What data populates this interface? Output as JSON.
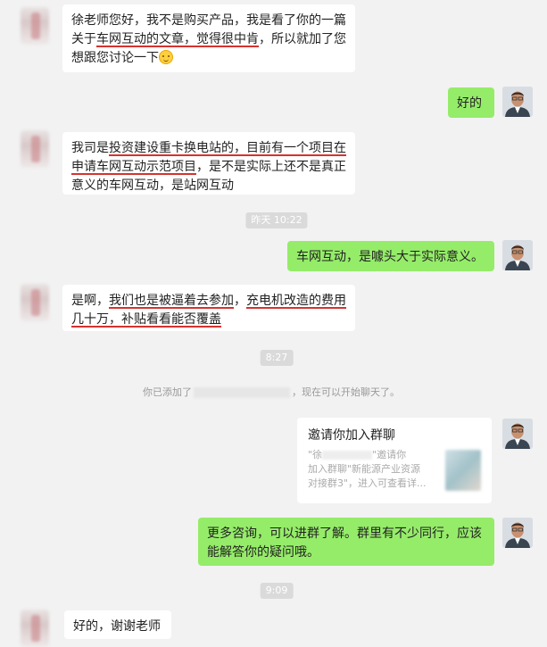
{
  "messages": {
    "m1": {
      "seg1": "徐老师您好，我不是购买产品，我是看了你的一篇",
      "seg2": "关于",
      "seg3": "车网互动的文章，觉得很中肯",
      "seg4": "，所以就加了您",
      "seg5": "想跟您讨论一下"
    },
    "m2": "好的",
    "m3": {
      "seg1": "我司是",
      "seg2": "投资建设重卡换电站的，目前有一个项目在",
      "seg3": "申请车网互动示范项目",
      "seg4": "，是不是实际上还不是真正",
      "seg5": "意义的车网互动，是站网互动"
    },
    "ts1": "昨天 10:22",
    "m4": "车网互动，是噱头大于实际意义。",
    "m5": {
      "seg1": "是啊，",
      "seg2": "我们也是被逼着去参加",
      "seg3": "，",
      "seg4": "充电机改造的费用",
      "seg5": "几十万，补贴看看能否覆盖"
    },
    "ts2": "8:27",
    "sys": {
      "prefix": "你已添加了",
      "suffix": "，现在可以开始聊天了。"
    },
    "card": {
      "title": "邀请你加入群聊",
      "line1": "\"徐",
      "line1b": "\"邀请你",
      "line2": "加入群聊\"新能源产业资源",
      "line3": "对接群3\"，进入可查看详..."
    },
    "m6": {
      "line1": "更多咨询，可以进群了解。群里有不少同行，应该",
      "line2": "能解答你的疑问哦。"
    },
    "ts3": "9:09",
    "m7": "好的，谢谢老师"
  },
  "colors": {
    "background": "#f2f2f2",
    "bubble_self": "#95ec69",
    "bubble_other": "#ffffff",
    "underline": "#d4332f"
  },
  "icons": [
    "smile-emoji-icon"
  ]
}
